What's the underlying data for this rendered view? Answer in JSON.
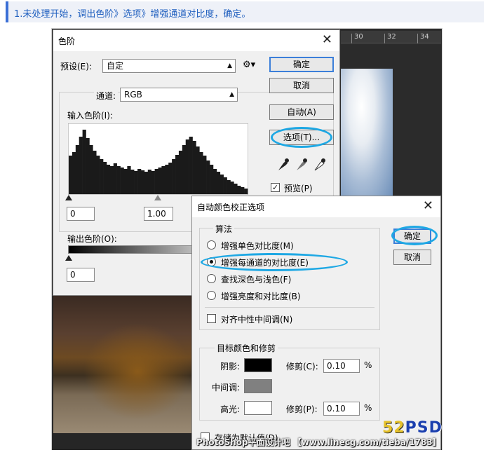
{
  "heading": "1.未处理开始，调出色阶》选项》增强通道对比度，确定。",
  "ruler": [
    "30",
    "32",
    "34"
  ],
  "levels_dialog": {
    "title": "色阶",
    "preset_label": "预设(E):",
    "preset_value": "自定",
    "channel_label": "通道:",
    "channel_value": "RGB",
    "input_levels_label": "输入色阶(I):",
    "output_levels_label": "输出色阶(O):",
    "input_black": "0",
    "input_gamma": "1.00",
    "output_black": "0",
    "buttons": {
      "ok": "确定",
      "cancel": "取消",
      "auto": "自动(A)",
      "options": "选项(T)..."
    },
    "preview_label": "预览(P)"
  },
  "auto_color_dialog": {
    "title": "自动颜色校正选项",
    "algorithms_label": "算法",
    "algorithms": [
      {
        "label": "增强单色对比度(M)",
        "selected": false
      },
      {
        "label": "增强每通道的对比度(E)",
        "selected": true
      },
      {
        "label": "查找深色与浅色(F)",
        "selected": false
      },
      {
        "label": "增强亮度和对比度(B)",
        "selected": false
      }
    ],
    "snap_neutral_label": "对齐中性中间调(N)",
    "target_label": "目标颜色和修剪",
    "shadows_label": "阴影:",
    "midtones_label": "中间调:",
    "highlights_label": "高光:",
    "clip_c_label": "修剪(C):",
    "clip_c_value": "0.10",
    "clip_p_label": "修剪(P):",
    "clip_p_value": "0.10",
    "percent": "%",
    "save_default_label": "存储为默认值(D)",
    "buttons": {
      "ok": "确定",
      "cancel": "取消"
    },
    "colors": {
      "shadows": "#000000",
      "midtones": "#808080",
      "highlights": "#ffffff"
    }
  },
  "histogram_levels": [
    0.55,
    0.6,
    0.7,
    0.82,
    0.92,
    0.8,
    0.7,
    0.62,
    0.55,
    0.5,
    0.46,
    0.42,
    0.4,
    0.44,
    0.4,
    0.38,
    0.36,
    0.4,
    0.35,
    0.33,
    0.36,
    0.34,
    0.32,
    0.35,
    0.33,
    0.36,
    0.38,
    0.4,
    0.42,
    0.45,
    0.5,
    0.56,
    0.62,
    0.7,
    0.78,
    0.82,
    0.76,
    0.68,
    0.6,
    0.55,
    0.48,
    0.42,
    0.36,
    0.32,
    0.28,
    0.24,
    0.2,
    0.18,
    0.15,
    0.12,
    0.1,
    0.08
  ],
  "watermark": "PhotoShop平面设计吧 【www.linecg.com/tieba/1783】",
  "logo": {
    "part1": "52",
    "part2": "PSD"
  }
}
